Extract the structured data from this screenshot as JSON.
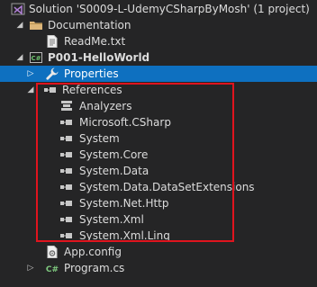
{
  "solution_explorer": {
    "solution": {
      "label": "Solution 'S0009-L-UdemyCSharpByMosh' (1 project)",
      "icon": "vs-solution-icon"
    },
    "documentation_folder": {
      "label": "Documentation",
      "icon": "folder-icon"
    },
    "readme_file": {
      "label": "ReadMe.txt",
      "icon": "text-file-icon"
    },
    "project": {
      "label": "P001-HelloWorld",
      "icon": "csharp-project-icon"
    },
    "properties": {
      "label": "Properties",
      "icon": "wrench-icon"
    },
    "references": {
      "label": "References",
      "icon": "references-icon"
    },
    "reference_items": [
      {
        "label": "Analyzers",
        "icon": "analyzers-icon"
      },
      {
        "label": "Microsoft.CSharp",
        "icon": "reference-icon"
      },
      {
        "label": "System",
        "icon": "reference-icon"
      },
      {
        "label": "System.Core",
        "icon": "reference-icon"
      },
      {
        "label": "System.Data",
        "icon": "reference-icon"
      },
      {
        "label": "System.Data.DataSetExtensions",
        "icon": "reference-icon"
      },
      {
        "label": "System.Net.Http",
        "icon": "reference-icon"
      },
      {
        "label": "System.Xml",
        "icon": "reference-icon"
      },
      {
        "label": "System.Xml.Linq",
        "icon": "reference-icon"
      }
    ],
    "app_config": {
      "label": "App.config",
      "icon": "config-file-icon"
    },
    "program_cs": {
      "label": "Program.cs",
      "icon": "csharp-file-icon",
      "badge": "C#"
    },
    "colors": {
      "background": "#252526",
      "selection": "#0e70c0",
      "highlight_border": "#e0141e",
      "folder": "#dcb67a",
      "csharp": "#68217a"
    }
  }
}
